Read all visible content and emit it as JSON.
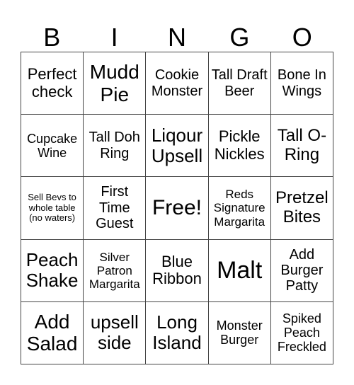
{
  "header": {
    "letters": [
      "B",
      "I",
      "N",
      "G",
      "O"
    ]
  },
  "board": {
    "rows": [
      [
        "Perfect check",
        "Mudd Pie",
        "Cookie Monster",
        "Tall Draft Beer",
        "Bone In Wings"
      ],
      [
        "Cupcake Wine",
        "Tall Doh Ring",
        "Liqour Upsell",
        "Pickle Nickles",
        "Tall O-Ring"
      ],
      [
        "Sell Bevs to whole table (no waters)",
        "First Time Guest",
        "Free!",
        "Reds Signature Margarita",
        "Pretzel Bites"
      ],
      [
        "Peach Shake",
        "Silver Patron Margarita",
        "Blue Ribbon",
        "Malt",
        "Add Burger Patty"
      ],
      [
        "Add Salad",
        "upsell side",
        "Long Island",
        "Monster Burger",
        "Spiked Peach Freckled"
      ]
    ],
    "free_space": {
      "row": 2,
      "col": 2
    }
  }
}
